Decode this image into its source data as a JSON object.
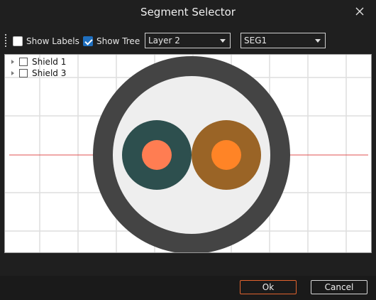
{
  "dialog": {
    "title": "Segment Selector",
    "close_icon": "close-icon"
  },
  "toolbar": {
    "show_labels": {
      "label": "Show Labels",
      "checked": false
    },
    "show_tree": {
      "label": "Show Tree",
      "checked": true
    },
    "layer_select": {
      "value": "Layer 2"
    },
    "segment_select": {
      "value": "SEG1"
    }
  },
  "tree": {
    "items": [
      {
        "label": "Shield 1",
        "checked": false
      },
      {
        "label": "Shield 3",
        "checked": false
      }
    ]
  },
  "cable": {
    "jacket_color": "#444444",
    "inner_fill": "#eeeeee",
    "conductor_left": {
      "insulation": "#2d4f4e",
      "core": "#ff7d52"
    },
    "conductor_right": {
      "insulation": "#9a6426",
      "core": "#ff8426"
    },
    "axis_color": "#e05050",
    "grid_color": "#dedede"
  },
  "footer": {
    "ok_label": "Ok",
    "cancel_label": "Cancel"
  }
}
